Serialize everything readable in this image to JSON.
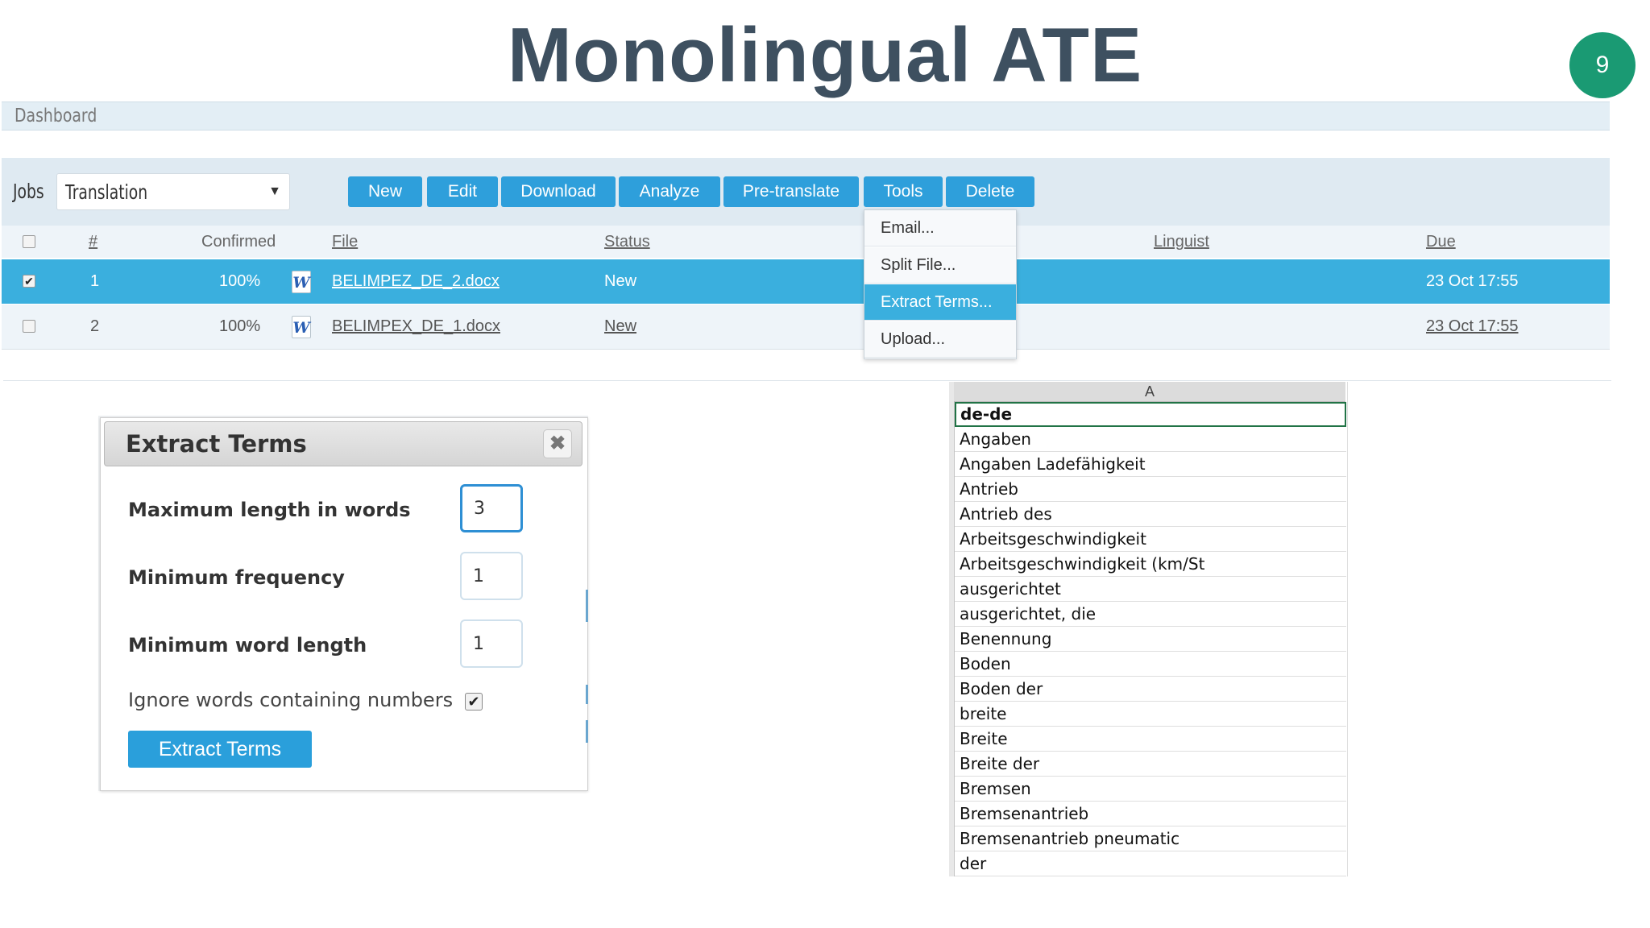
{
  "slide": {
    "title": "Monolingual ATE",
    "page_number": "9"
  },
  "dashboard": {
    "label": "Dashboard"
  },
  "jobs": {
    "label": "Jobs",
    "job_type": "Translation",
    "buttons": {
      "new": "New",
      "edit": "Edit",
      "download": "Download",
      "analyze": "Analyze",
      "pretranslate": "Pre-translate",
      "tools": "Tools",
      "delete": "Delete"
    },
    "headers": {
      "num": "#",
      "confirmed": "Confirmed",
      "file": "File",
      "status": "Status",
      "linguist": "Linguist",
      "due": "Due"
    },
    "rows": [
      {
        "num": "1",
        "confirmed": "100%",
        "file": "BELIMPEZ_DE_2.docx",
        "status": "New",
        "due": "23 Oct 17:55",
        "checked": true
      },
      {
        "num": "2",
        "confirmed": "100%",
        "file": "BELIMPEX_DE_1.docx",
        "status": "New",
        "due": "23 Oct 17:55",
        "checked": false
      }
    ],
    "file_icon_letter": "W"
  },
  "tools_menu": {
    "items": [
      "Email...",
      "Split File...",
      "Extract Terms...",
      "Upload..."
    ],
    "active_index": 2
  },
  "dialog": {
    "title": "Extract Terms",
    "close_glyph": "✖",
    "fields": {
      "max_length": {
        "label": "Maximum length in words",
        "value": "3"
      },
      "min_frequency": {
        "label": "Minimum frequency",
        "value": "1"
      },
      "min_word_length": {
        "label": "Minimum word length",
        "value": "1"
      }
    },
    "ignore_numbers": {
      "label": "Ignore words containing numbers",
      "checked": true
    },
    "submit_label": "Extract Terms"
  },
  "spreadsheet": {
    "column": "A",
    "cells": [
      "de-de",
      "Angaben",
      "Angaben Ladefähigkeit",
      "Antrieb",
      "Antrieb des",
      "Arbeitsgeschwindigkeit",
      "Arbeitsgeschwindigkeit (km/St",
      "ausgerichtet",
      "ausgerichtet, die",
      "Benennung",
      "Boden",
      "Boden der",
      "breite",
      "Breite",
      "Breite der",
      "Bremsen",
      "Bremsenantrieb",
      "Bremsenantrieb pneumatic",
      "der"
    ]
  },
  "colors": {
    "accent": "#2e9fdb",
    "selected_row": "#3aafde",
    "title": "#3e5060",
    "badge": "#1a9a73",
    "excel_green": "#217346"
  }
}
